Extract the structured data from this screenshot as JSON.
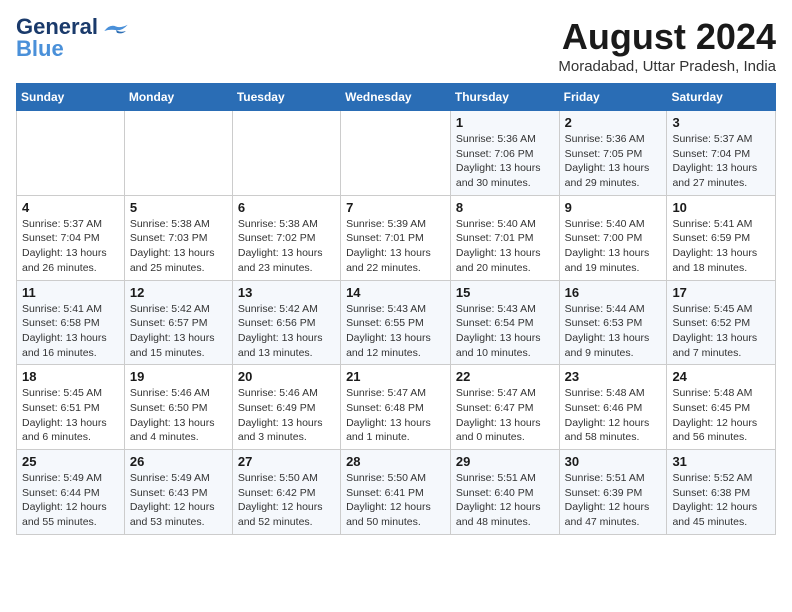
{
  "header": {
    "logo_line1": "General",
    "logo_line2": "Blue",
    "month_year": "August 2024",
    "location": "Moradabad, Uttar Pradesh, India"
  },
  "weekdays": [
    "Sunday",
    "Monday",
    "Tuesday",
    "Wednesday",
    "Thursday",
    "Friday",
    "Saturday"
  ],
  "weeks": [
    [
      {
        "day": "",
        "info": ""
      },
      {
        "day": "",
        "info": ""
      },
      {
        "day": "",
        "info": ""
      },
      {
        "day": "",
        "info": ""
      },
      {
        "day": "1",
        "info": "Sunrise: 5:36 AM\nSunset: 7:06 PM\nDaylight: 13 hours\nand 30 minutes."
      },
      {
        "day": "2",
        "info": "Sunrise: 5:36 AM\nSunset: 7:05 PM\nDaylight: 13 hours\nand 29 minutes."
      },
      {
        "day": "3",
        "info": "Sunrise: 5:37 AM\nSunset: 7:04 PM\nDaylight: 13 hours\nand 27 minutes."
      }
    ],
    [
      {
        "day": "4",
        "info": "Sunrise: 5:37 AM\nSunset: 7:04 PM\nDaylight: 13 hours\nand 26 minutes."
      },
      {
        "day": "5",
        "info": "Sunrise: 5:38 AM\nSunset: 7:03 PM\nDaylight: 13 hours\nand 25 minutes."
      },
      {
        "day": "6",
        "info": "Sunrise: 5:38 AM\nSunset: 7:02 PM\nDaylight: 13 hours\nand 23 minutes."
      },
      {
        "day": "7",
        "info": "Sunrise: 5:39 AM\nSunset: 7:01 PM\nDaylight: 13 hours\nand 22 minutes."
      },
      {
        "day": "8",
        "info": "Sunrise: 5:40 AM\nSunset: 7:01 PM\nDaylight: 13 hours\nand 20 minutes."
      },
      {
        "day": "9",
        "info": "Sunrise: 5:40 AM\nSunset: 7:00 PM\nDaylight: 13 hours\nand 19 minutes."
      },
      {
        "day": "10",
        "info": "Sunrise: 5:41 AM\nSunset: 6:59 PM\nDaylight: 13 hours\nand 18 minutes."
      }
    ],
    [
      {
        "day": "11",
        "info": "Sunrise: 5:41 AM\nSunset: 6:58 PM\nDaylight: 13 hours\nand 16 minutes."
      },
      {
        "day": "12",
        "info": "Sunrise: 5:42 AM\nSunset: 6:57 PM\nDaylight: 13 hours\nand 15 minutes."
      },
      {
        "day": "13",
        "info": "Sunrise: 5:42 AM\nSunset: 6:56 PM\nDaylight: 13 hours\nand 13 minutes."
      },
      {
        "day": "14",
        "info": "Sunrise: 5:43 AM\nSunset: 6:55 PM\nDaylight: 13 hours\nand 12 minutes."
      },
      {
        "day": "15",
        "info": "Sunrise: 5:43 AM\nSunset: 6:54 PM\nDaylight: 13 hours\nand 10 minutes."
      },
      {
        "day": "16",
        "info": "Sunrise: 5:44 AM\nSunset: 6:53 PM\nDaylight: 13 hours\nand 9 minutes."
      },
      {
        "day": "17",
        "info": "Sunrise: 5:45 AM\nSunset: 6:52 PM\nDaylight: 13 hours\nand 7 minutes."
      }
    ],
    [
      {
        "day": "18",
        "info": "Sunrise: 5:45 AM\nSunset: 6:51 PM\nDaylight: 13 hours\nand 6 minutes."
      },
      {
        "day": "19",
        "info": "Sunrise: 5:46 AM\nSunset: 6:50 PM\nDaylight: 13 hours\nand 4 minutes."
      },
      {
        "day": "20",
        "info": "Sunrise: 5:46 AM\nSunset: 6:49 PM\nDaylight: 13 hours\nand 3 minutes."
      },
      {
        "day": "21",
        "info": "Sunrise: 5:47 AM\nSunset: 6:48 PM\nDaylight: 13 hours\nand 1 minute."
      },
      {
        "day": "22",
        "info": "Sunrise: 5:47 AM\nSunset: 6:47 PM\nDaylight: 13 hours\nand 0 minutes."
      },
      {
        "day": "23",
        "info": "Sunrise: 5:48 AM\nSunset: 6:46 PM\nDaylight: 12 hours\nand 58 minutes."
      },
      {
        "day": "24",
        "info": "Sunrise: 5:48 AM\nSunset: 6:45 PM\nDaylight: 12 hours\nand 56 minutes."
      }
    ],
    [
      {
        "day": "25",
        "info": "Sunrise: 5:49 AM\nSunset: 6:44 PM\nDaylight: 12 hours\nand 55 minutes."
      },
      {
        "day": "26",
        "info": "Sunrise: 5:49 AM\nSunset: 6:43 PM\nDaylight: 12 hours\nand 53 minutes."
      },
      {
        "day": "27",
        "info": "Sunrise: 5:50 AM\nSunset: 6:42 PM\nDaylight: 12 hours\nand 52 minutes."
      },
      {
        "day": "28",
        "info": "Sunrise: 5:50 AM\nSunset: 6:41 PM\nDaylight: 12 hours\nand 50 minutes."
      },
      {
        "day": "29",
        "info": "Sunrise: 5:51 AM\nSunset: 6:40 PM\nDaylight: 12 hours\nand 48 minutes."
      },
      {
        "day": "30",
        "info": "Sunrise: 5:51 AM\nSunset: 6:39 PM\nDaylight: 12 hours\nand 47 minutes."
      },
      {
        "day": "31",
        "info": "Sunrise: 5:52 AM\nSunset: 6:38 PM\nDaylight: 12 hours\nand 45 minutes."
      }
    ]
  ]
}
